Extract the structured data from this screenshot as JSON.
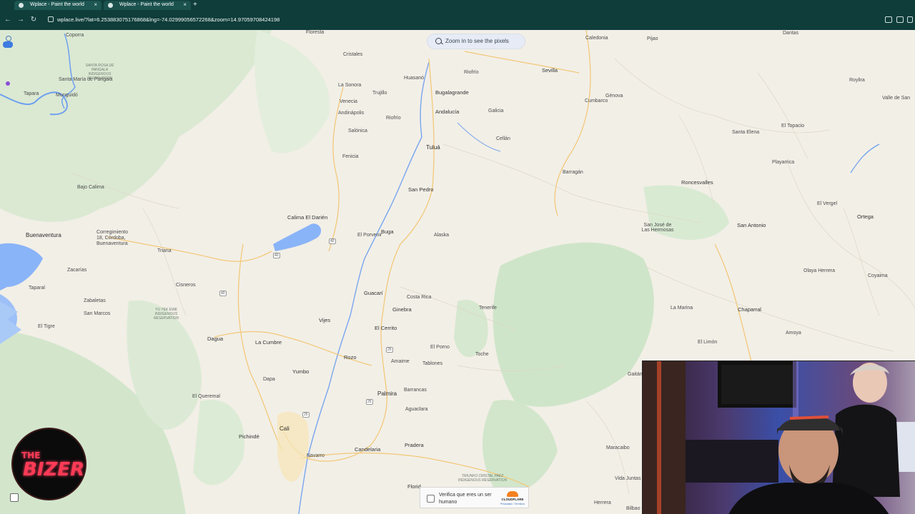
{
  "browser": {
    "tabs": [
      {
        "title": "Wplace - Paint the world",
        "close": "×"
      },
      {
        "title": "Wplace - Paint the world",
        "close": "×"
      }
    ],
    "new_tab": "+",
    "nav": {
      "back": "←",
      "forward": "→",
      "reload": "↻"
    },
    "url": "wplace.live/?lat=6.253883075176868&lng=-74.02999056572268&zoom=14.97059708424198"
  },
  "map": {
    "zoom_prompt": "Zoom in to see the pixels",
    "places": [
      {
        "name": "Coporra",
        "cls": ""
      },
      {
        "name": "Florestа",
        "cls": ""
      },
      {
        "name": "Caledonia",
        "cls": ""
      },
      {
        "name": "Pijao",
        "cls": ""
      },
      {
        "name": "Dantas",
        "cls": ""
      },
      {
        "name": "Cristales",
        "cls": ""
      },
      {
        "name": "Huasanó",
        "cls": ""
      },
      {
        "name": "Sevilla",
        "cls": "big"
      },
      {
        "name": "Riofrío",
        "cls": ""
      },
      {
        "name": "Santa María de Pangala",
        "cls": ""
      },
      {
        "name": "Tapara",
        "cls": ""
      },
      {
        "name": "Munguidó",
        "cls": ""
      },
      {
        "name": "La Sonora",
        "cls": ""
      },
      {
        "name": "Trujillo",
        "cls": ""
      },
      {
        "name": "Bugalagrande",
        "cls": "big"
      },
      {
        "name": "Génova",
        "cls": ""
      },
      {
        "name": "Roylira",
        "cls": ""
      },
      {
        "name": "Venecia",
        "cls": ""
      },
      {
        "name": "Andalucía",
        "cls": "big"
      },
      {
        "name": "Galicia",
        "cls": ""
      },
      {
        "name": "Cumbarco",
        "cls": ""
      },
      {
        "name": "Valle de San",
        "cls": ""
      },
      {
        "name": "Andinápolis",
        "cls": ""
      },
      {
        "name": "Riofrío",
        "cls": ""
      },
      {
        "name": "Salónica",
        "cls": ""
      },
      {
        "name": "Cellán",
        "cls": ""
      },
      {
        "name": "Santa Elena",
        "cls": ""
      },
      {
        "name": "El Topacio",
        "cls": ""
      },
      {
        "name": "Tuluá",
        "cls": "bigger"
      },
      {
        "name": "Fenicia",
        "cls": ""
      },
      {
        "name": "Barragán",
        "cls": ""
      },
      {
        "name": "Playarrica",
        "cls": ""
      },
      {
        "name": "Bajo Calima",
        "cls": ""
      },
      {
        "name": "San Pedro",
        "cls": "big"
      },
      {
        "name": "Roncesvalles",
        "cls": "big"
      },
      {
        "name": "El Vergel",
        "cls": ""
      },
      {
        "name": "Calima El Darién",
        "cls": "big"
      },
      {
        "name": "Ortega",
        "cls": "big"
      },
      {
        "name": "Buenaventura",
        "cls": "bigger"
      },
      {
        "name": "Corregimiento 18, Córdoba, Buenaventura",
        "cls": ""
      },
      {
        "name": "El Porvenir",
        "cls": ""
      },
      {
        "name": "Buga",
        "cls": "big"
      },
      {
        "name": "Alaska",
        "cls": ""
      },
      {
        "name": "San José de Las Hermosas",
        "cls": ""
      },
      {
        "name": "San Antonio",
        "cls": "big"
      },
      {
        "name": "Triana",
        "cls": ""
      },
      {
        "name": "Zacarías",
        "cls": ""
      },
      {
        "name": "Olaya Herrera",
        "cls": ""
      },
      {
        "name": "Coyaima",
        "cls": ""
      },
      {
        "name": "Cisneros",
        "cls": ""
      },
      {
        "name": "Taparal",
        "cls": ""
      },
      {
        "name": "Guacarí",
        "cls": "big"
      },
      {
        "name": "Costa Rica",
        "cls": ""
      },
      {
        "name": "Zabaletas",
        "cls": ""
      },
      {
        "name": "Tenerife",
        "cls": ""
      },
      {
        "name": "La Marina",
        "cls": ""
      },
      {
        "name": "Chaparral",
        "cls": "big"
      },
      {
        "name": "San Marcos",
        "cls": ""
      },
      {
        "name": "Ginebra",
        "cls": "big"
      },
      {
        "name": "El Tigre",
        "cls": ""
      },
      {
        "name": "Vijes",
        "cls": "big"
      },
      {
        "name": "El Cerrito",
        "cls": "big"
      },
      {
        "name": "Amoya",
        "cls": ""
      },
      {
        "name": "Dagua",
        "cls": "big"
      },
      {
        "name": "La Cumbre",
        "cls": "big"
      },
      {
        "name": "El Limón",
        "cls": ""
      },
      {
        "name": "El Porno",
        "cls": ""
      },
      {
        "name": "Toche",
        "cls": ""
      },
      {
        "name": "Rozo",
        "cls": "big"
      },
      {
        "name": "Amaime",
        "cls": ""
      },
      {
        "name": "Tablones",
        "cls": ""
      },
      {
        "name": "Gaitán",
        "cls": ""
      },
      {
        "name": "Yumbo",
        "cls": "big"
      },
      {
        "name": "Dapa",
        "cls": ""
      },
      {
        "name": "Palmira",
        "cls": "bigger"
      },
      {
        "name": "Barrancas",
        "cls": ""
      },
      {
        "name": "El Queremal",
        "cls": ""
      },
      {
        "name": "Aguaclara",
        "cls": ""
      },
      {
        "name": "Cali",
        "cls": "bigger"
      },
      {
        "name": "Pichindé",
        "cls": "big"
      },
      {
        "name": "Navarro",
        "cls": ""
      },
      {
        "name": "Candelaria",
        "cls": "big"
      },
      {
        "name": "Pradera",
        "cls": "big"
      },
      {
        "name": "Maracaibo",
        "cls": ""
      },
      {
        "name": "Florid",
        "cls": "big"
      },
      {
        "name": "Vida Juntas",
        "cls": ""
      },
      {
        "name": "Herrera",
        "cls": ""
      },
      {
        "name": "Bilbao",
        "cls": ""
      }
    ],
    "territories": [
      "SANTA ROSA DE PANGALA INDIGENOUS RESERVATION",
      "YU YEK EWE INDIGENOUS RESERVATION",
      "TRIUNFO CRISTAL PAEZ INDIGENOUS RESERVATION"
    ],
    "shields": [
      "40",
      "40",
      "40",
      "25",
      "25",
      "25"
    ]
  },
  "captcha": {
    "label": "Verifica que eres un ser humano",
    "brand": "CLOUDFLARE",
    "links": "Privacidad • Términos"
  },
  "logo": {
    "line1": "THE",
    "line2": "BIZER"
  },
  "colors": {
    "browser_bg": "#0f3d3a",
    "map_bg": "#f2efe7",
    "water": "#8ab4f8",
    "forest": "#cfe5c9",
    "accent_pill": "#e6ebf5"
  }
}
